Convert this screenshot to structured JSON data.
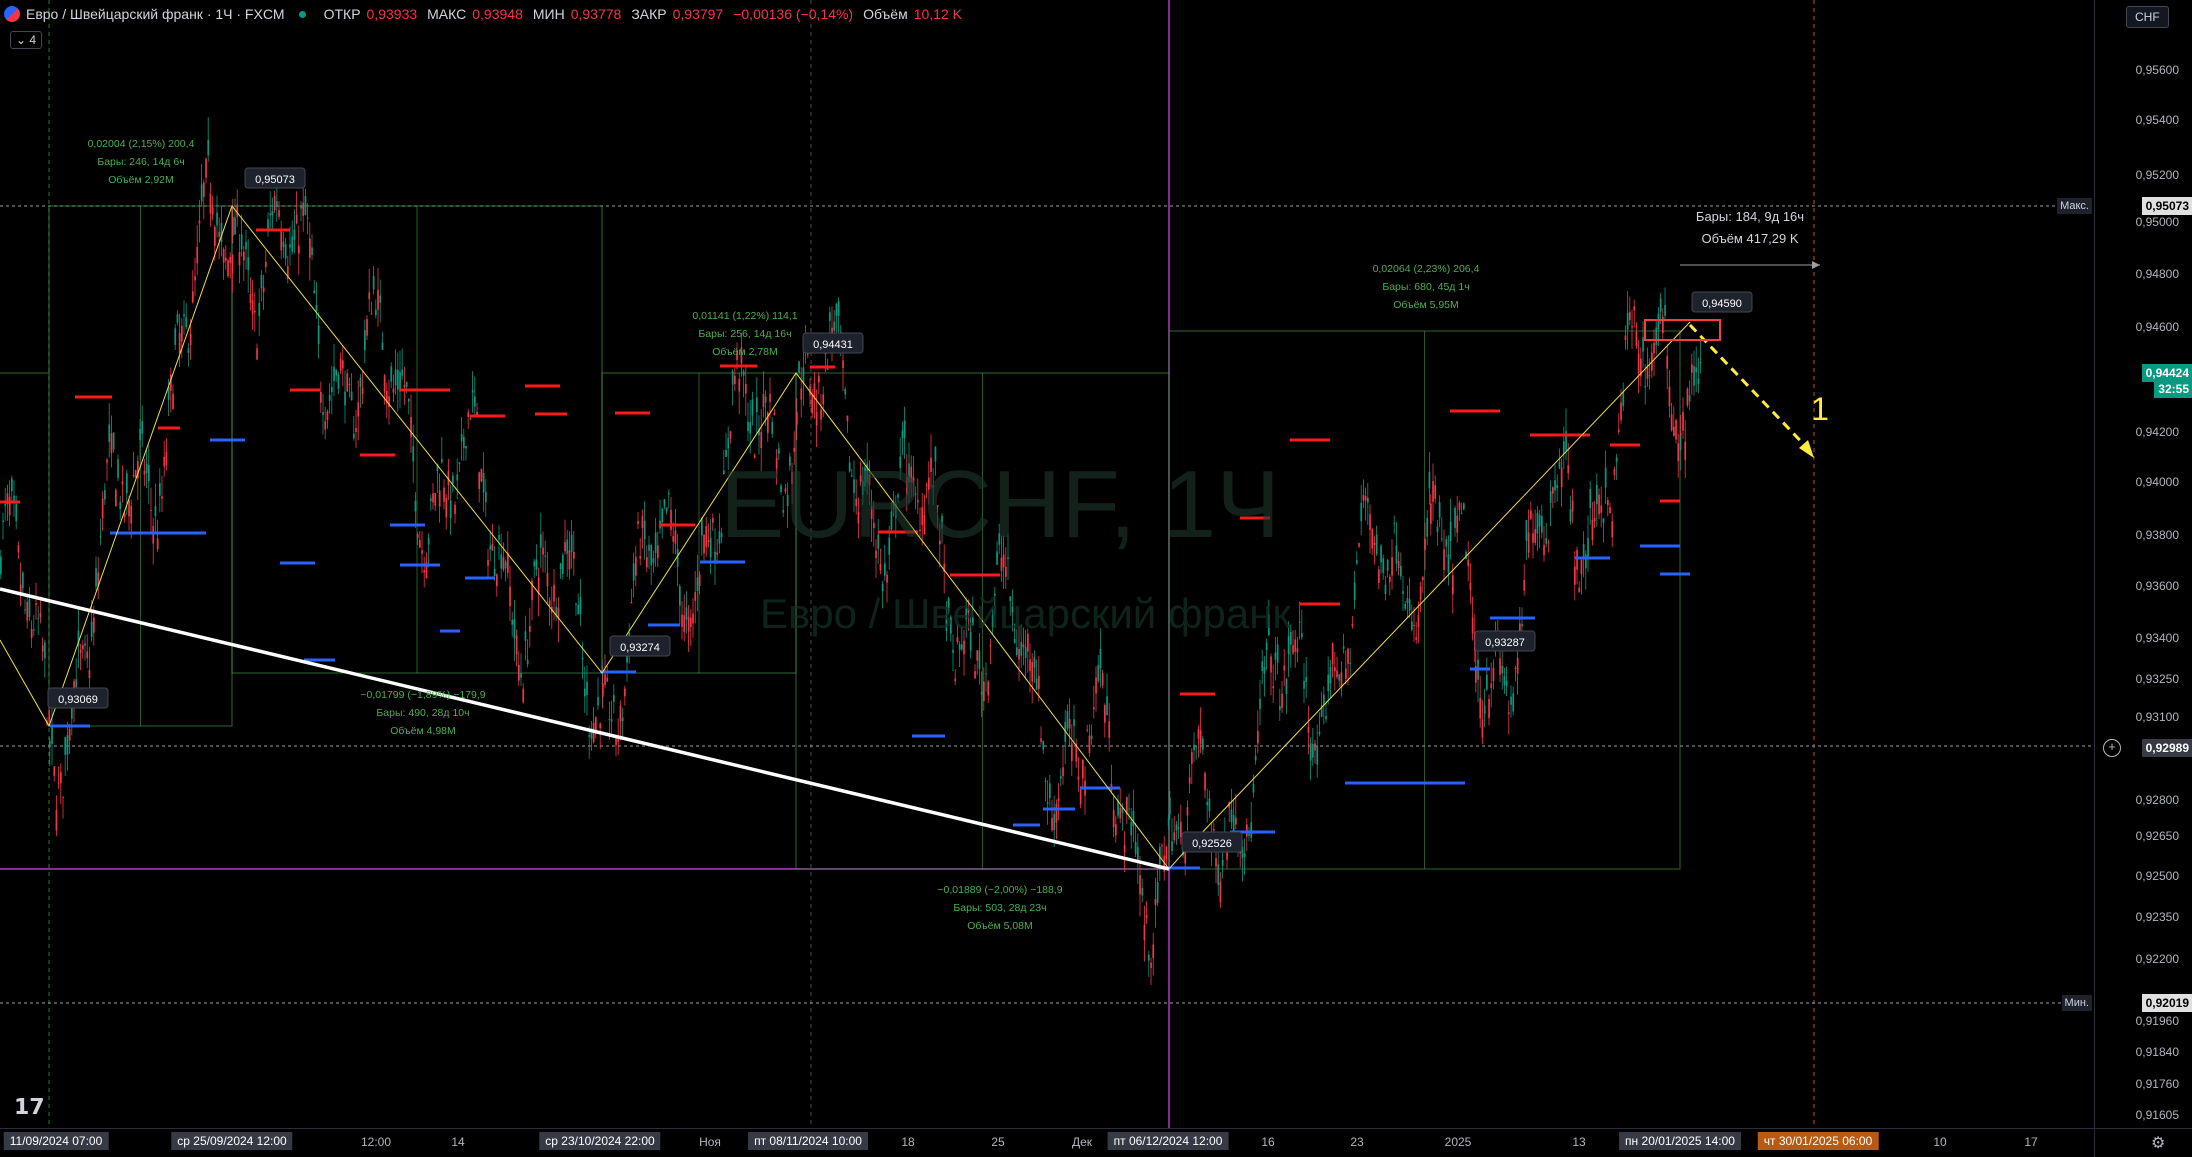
{
  "legend": {
    "symbol": "Евро / Швейцарский франк · 1Ч · FXCM",
    "open_label": "ОТКР",
    "open_value": "0,93933",
    "high_label": "МАКС",
    "high_value": "0,93948",
    "low_label": "МИН",
    "low_value": "0,93778",
    "close_label": "ЗАКР",
    "close_value": "0,93797",
    "change_value": "−0,00136 (−0,14%)",
    "volume_label": "Объём",
    "volume_value": "10,12 K",
    "collapse_label": "⌄ 4"
  },
  "currency_button": "CHF",
  "watermark": {
    "symbol": "EURCHF, 1Ч",
    "description": "Евро / Швейцарский франк"
  },
  "price_axis": {
    "ticks": [
      "0,95600",
      "0,95400",
      "0,95200",
      "0,95000",
      "0,94800",
      "0,94600",
      "0,94200",
      "0,94000",
      "0,93800",
      "0,93600",
      "0,93400",
      "0,93250",
      "0,93100",
      "0,92800",
      "0,92650",
      "0,92500",
      "0,92350",
      "0,92200",
      "0,91960",
      "0,91840",
      "0,91760",
      "0,91605"
    ],
    "high_label": "Макс.",
    "high_value": "0,95073",
    "low_label": "Мин.",
    "low_value": "0,92019",
    "current_price": "0,94424",
    "countdown": "32:55",
    "crosshair_price": "0,92989"
  },
  "time_axis": {
    "ticks": [
      "12:00",
      "14",
      "Ноя",
      "18",
      "25",
      "Дек",
      "16",
      "23",
      "2025",
      "13",
      "10",
      "17"
    ],
    "tags": [
      "11/09/2024  07:00",
      "ср 25/09/2024  12:00",
      "ср 23/10/2024  22:00",
      "пт 08/11/2024  10:00",
      "пт 06/12/2024  12:00",
      "пн 20/01/2025  14:00"
    ],
    "highlight_tag": "чт 30/01/2025  06:00"
  },
  "annotations": {
    "pivots": [
      "0,95073",
      "0,93069",
      "0,93274",
      "0,94431",
      "0,92526",
      "0,93287",
      "0,94590"
    ],
    "range_1": {
      "change": "0,02004 (2,15%) 200,4",
      "bars": "Бары: 246, 14д 6ч",
      "volume": "Объём 2,92M"
    },
    "range_2": {
      "change": "−0,01799 (−1,89%) −179,9",
      "bars": "Бары: 490, 28д 10ч",
      "volume": "Объём 4,98M"
    },
    "range_3": {
      "change": "0,01141 (1,22%) 114,1",
      "bars": "Бары: 256, 14д 16ч",
      "volume": "Объём 2,78M"
    },
    "range_4": {
      "change": "−0,01889 (−2,00%) −188,9",
      "bars": "Бары: 503, 28д 23ч",
      "volume": "Объём 5,08M"
    },
    "range_5": {
      "change": "0,02064 (2,23%) 206,4",
      "bars": "Бары: 680, 45д 1ч",
      "volume": "Объём 5,95M"
    },
    "projection": {
      "bars": "Бары: 184, 9д 16ч",
      "volume": "Объём 417,29 K"
    },
    "wave_label": "1"
  },
  "colors": {
    "up": "#089981",
    "down": "#f23645",
    "range_green": "#4caf50",
    "zigzag": "#f0e040",
    "trendline": "#ffffff",
    "level_red": "#ff1a1a",
    "level_blue": "#2962ff",
    "arrow": "#ffeb3b"
  },
  "icons": {
    "logo": "tradingview-logo-icon",
    "settings": "gear-icon",
    "flag": "eur-chf-flag-icon"
  }
}
